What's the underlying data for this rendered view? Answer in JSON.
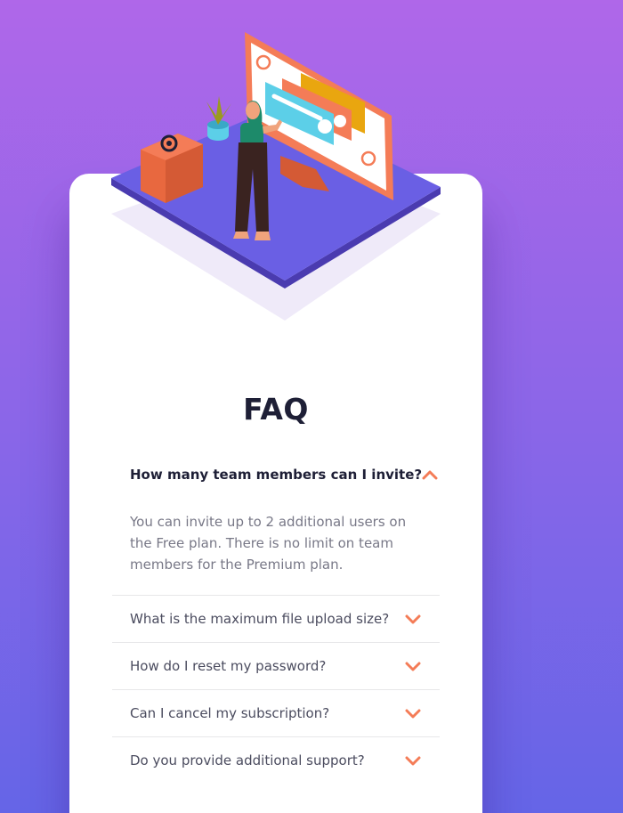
{
  "title": "FAQ",
  "accent_color": "#f47c57",
  "faqs": [
    {
      "question": "How many team members can I invite?",
      "answer": "You can invite up to 2 additional users on the Free plan. There is no limit on team members for the Premium plan.",
      "open": true,
      "icon": "chevron-up-icon"
    },
    {
      "question": "What is the maximum file upload size?",
      "open": false,
      "icon": "chevron-down-icon"
    },
    {
      "question": "How do I reset my password?",
      "open": false,
      "icon": "chevron-down-icon"
    },
    {
      "question": "Can I cancel my subscription?",
      "open": false,
      "icon": "chevron-down-icon"
    },
    {
      "question": "Do you provide additional support?",
      "open": false,
      "icon": "chevron-down-icon"
    }
  ]
}
